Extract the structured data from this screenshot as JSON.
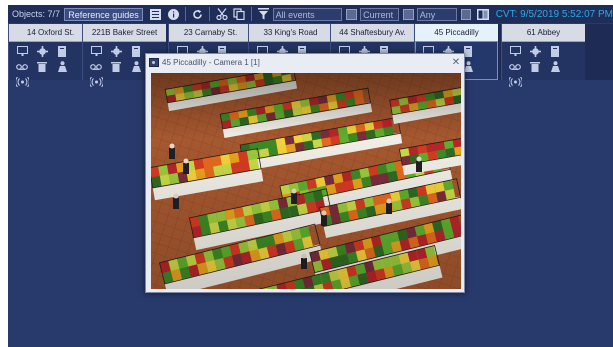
{
  "toolbar": {
    "objects_label": "Objects: 7/7",
    "reference_guides_label": "Reference guides",
    "event_filter": "All events",
    "time_filter": "Current",
    "range_filter": "Any",
    "cvt_text": "CVT: 9/5/2019 5:52:07 PM",
    "icons": [
      "list-icon",
      "info-icon",
      "refresh-icon",
      "scissors-icon",
      "copy-icon",
      "filter-icon",
      "checkbox-icon",
      "checkbox-icon",
      "checkbox-icon",
      "book-icon"
    ]
  },
  "cameras": [
    {
      "name": "14 Oxford St."
    },
    {
      "name": "221B Baker Street"
    },
    {
      "name": "23 Carnaby St."
    },
    {
      "name": "33 King's Road"
    },
    {
      "name": "44 Shaftesbury Av."
    },
    {
      "name": "45 Piccadilly"
    },
    {
      "name": "61 Abbey"
    }
  ],
  "active_camera": "45 Piccadilly",
  "camera_icons": [
    "monitor-icon",
    "gear-icon",
    "archive-icon",
    "voicemail-icon",
    "trash-icon",
    "person-icon",
    "broadcast-icon"
  ],
  "popup": {
    "title": "45 Piccadilly - Camera 1 [1]",
    "close": "✕"
  },
  "colors": {
    "background": "#283a6c",
    "toolbar": "#1f2e59",
    "accent": "#2fa7e6",
    "floor": "#a0542e"
  }
}
